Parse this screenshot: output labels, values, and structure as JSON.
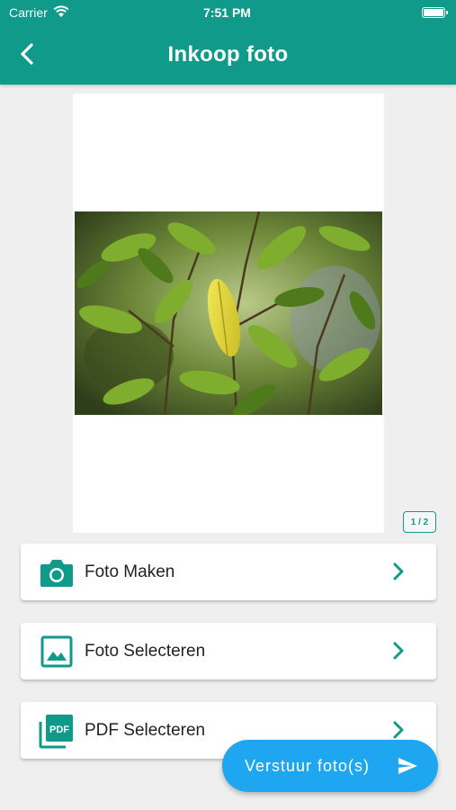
{
  "status_bar": {
    "carrier": "Carrier",
    "time": "7:51 PM"
  },
  "header": {
    "title": "Inkoop foto"
  },
  "preview": {
    "page_indicator": "1 / 2"
  },
  "actions": [
    {
      "label": "Foto Maken",
      "icon": "camera-icon"
    },
    {
      "label": "Foto Selecteren",
      "icon": "image-icon"
    },
    {
      "label": "PDF Selecteren",
      "icon": "pdf-icon"
    }
  ],
  "fab": {
    "label": "Verstuur foto(s)",
    "icon": "send-icon"
  },
  "colors": {
    "primary": "#0f9a8a",
    "accent": "#1ea7f0",
    "background": "#efefef"
  }
}
